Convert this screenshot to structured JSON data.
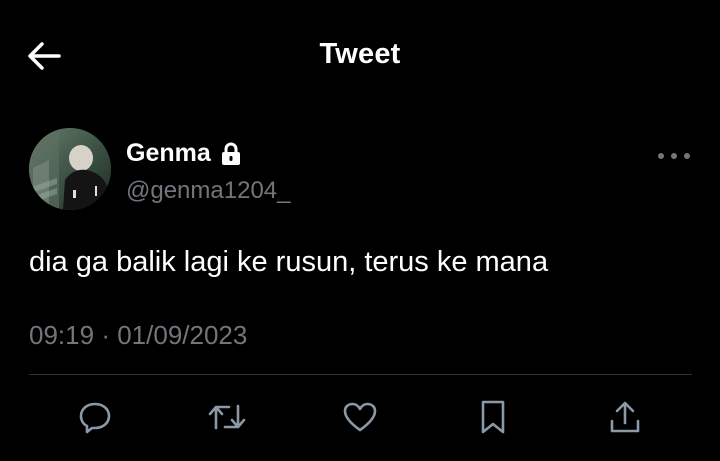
{
  "header": {
    "title": "Tweet",
    "back_icon": "arrow-left-icon"
  },
  "author": {
    "display_name": "Genma",
    "handle": "@genma1204_",
    "protected_icon": "lock-icon",
    "avatar": "profile-photo"
  },
  "tweet": {
    "text": "dia ga balik lagi ke rusun, terus ke mana",
    "time": "09:19",
    "separator": "·",
    "date": "01/09/2023"
  },
  "actions": [
    {
      "name": "reply",
      "icon": "reply-icon"
    },
    {
      "name": "retweet",
      "icon": "retweet-icon"
    },
    {
      "name": "like",
      "icon": "heart-icon"
    },
    {
      "name": "bookmark",
      "icon": "bookmark-icon"
    },
    {
      "name": "share",
      "icon": "share-icon"
    }
  ],
  "colors": {
    "background": "#000000",
    "primary_text": "#ffffff",
    "secondary_text": "#71767b",
    "divider": "#2f3336",
    "icon": "#8b98a5"
  }
}
